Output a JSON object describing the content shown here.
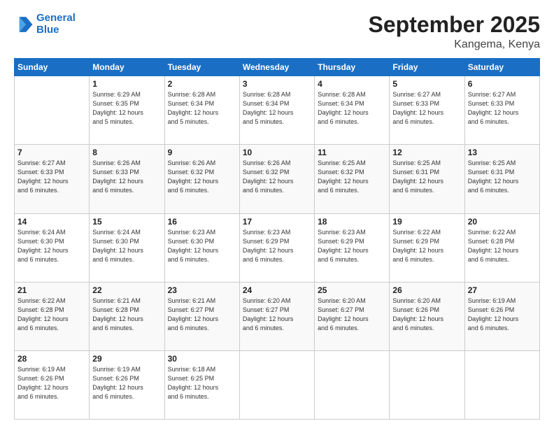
{
  "logo": {
    "line1": "General",
    "line2": "Blue"
  },
  "title": "September 2025",
  "location": "Kangema, Kenya",
  "days_header": [
    "Sunday",
    "Monday",
    "Tuesday",
    "Wednesday",
    "Thursday",
    "Friday",
    "Saturday"
  ],
  "weeks": [
    [
      {
        "num": "",
        "info": ""
      },
      {
        "num": "1",
        "info": "Sunrise: 6:29 AM\nSunset: 6:35 PM\nDaylight: 12 hours\nand 5 minutes."
      },
      {
        "num": "2",
        "info": "Sunrise: 6:28 AM\nSunset: 6:34 PM\nDaylight: 12 hours\nand 5 minutes."
      },
      {
        "num": "3",
        "info": "Sunrise: 6:28 AM\nSunset: 6:34 PM\nDaylight: 12 hours\nand 5 minutes."
      },
      {
        "num": "4",
        "info": "Sunrise: 6:28 AM\nSunset: 6:34 PM\nDaylight: 12 hours\nand 6 minutes."
      },
      {
        "num": "5",
        "info": "Sunrise: 6:27 AM\nSunset: 6:33 PM\nDaylight: 12 hours\nand 6 minutes."
      },
      {
        "num": "6",
        "info": "Sunrise: 6:27 AM\nSunset: 6:33 PM\nDaylight: 12 hours\nand 6 minutes."
      }
    ],
    [
      {
        "num": "7",
        "info": "Sunrise: 6:27 AM\nSunset: 6:33 PM\nDaylight: 12 hours\nand 6 minutes."
      },
      {
        "num": "8",
        "info": "Sunrise: 6:26 AM\nSunset: 6:33 PM\nDaylight: 12 hours\nand 6 minutes."
      },
      {
        "num": "9",
        "info": "Sunrise: 6:26 AM\nSunset: 6:32 PM\nDaylight: 12 hours\nand 6 minutes."
      },
      {
        "num": "10",
        "info": "Sunrise: 6:26 AM\nSunset: 6:32 PM\nDaylight: 12 hours\nand 6 minutes."
      },
      {
        "num": "11",
        "info": "Sunrise: 6:25 AM\nSunset: 6:32 PM\nDaylight: 12 hours\nand 6 minutes."
      },
      {
        "num": "12",
        "info": "Sunrise: 6:25 AM\nSunset: 6:31 PM\nDaylight: 12 hours\nand 6 minutes."
      },
      {
        "num": "13",
        "info": "Sunrise: 6:25 AM\nSunset: 6:31 PM\nDaylight: 12 hours\nand 6 minutes."
      }
    ],
    [
      {
        "num": "14",
        "info": "Sunrise: 6:24 AM\nSunset: 6:30 PM\nDaylight: 12 hours\nand 6 minutes."
      },
      {
        "num": "15",
        "info": "Sunrise: 6:24 AM\nSunset: 6:30 PM\nDaylight: 12 hours\nand 6 minutes."
      },
      {
        "num": "16",
        "info": "Sunrise: 6:23 AM\nSunset: 6:30 PM\nDaylight: 12 hours\nand 6 minutes."
      },
      {
        "num": "17",
        "info": "Sunrise: 6:23 AM\nSunset: 6:29 PM\nDaylight: 12 hours\nand 6 minutes."
      },
      {
        "num": "18",
        "info": "Sunrise: 6:23 AM\nSunset: 6:29 PM\nDaylight: 12 hours\nand 6 minutes."
      },
      {
        "num": "19",
        "info": "Sunrise: 6:22 AM\nSunset: 6:29 PM\nDaylight: 12 hours\nand 6 minutes."
      },
      {
        "num": "20",
        "info": "Sunrise: 6:22 AM\nSunset: 6:28 PM\nDaylight: 12 hours\nand 6 minutes."
      }
    ],
    [
      {
        "num": "21",
        "info": "Sunrise: 6:22 AM\nSunset: 6:28 PM\nDaylight: 12 hours\nand 6 minutes."
      },
      {
        "num": "22",
        "info": "Sunrise: 6:21 AM\nSunset: 6:28 PM\nDaylight: 12 hours\nand 6 minutes."
      },
      {
        "num": "23",
        "info": "Sunrise: 6:21 AM\nSunset: 6:27 PM\nDaylight: 12 hours\nand 6 minutes."
      },
      {
        "num": "24",
        "info": "Sunrise: 6:20 AM\nSunset: 6:27 PM\nDaylight: 12 hours\nand 6 minutes."
      },
      {
        "num": "25",
        "info": "Sunrise: 6:20 AM\nSunset: 6:27 PM\nDaylight: 12 hours\nand 6 minutes."
      },
      {
        "num": "26",
        "info": "Sunrise: 6:20 AM\nSunset: 6:26 PM\nDaylight: 12 hours\nand 6 minutes."
      },
      {
        "num": "27",
        "info": "Sunrise: 6:19 AM\nSunset: 6:26 PM\nDaylight: 12 hours\nand 6 minutes."
      }
    ],
    [
      {
        "num": "28",
        "info": "Sunrise: 6:19 AM\nSunset: 6:26 PM\nDaylight: 12 hours\nand 6 minutes."
      },
      {
        "num": "29",
        "info": "Sunrise: 6:19 AM\nSunset: 6:26 PM\nDaylight: 12 hours\nand 6 minutes."
      },
      {
        "num": "30",
        "info": "Sunrise: 6:18 AM\nSunset: 6:25 PM\nDaylight: 12 hours\nand 6 minutes."
      },
      {
        "num": "",
        "info": ""
      },
      {
        "num": "",
        "info": ""
      },
      {
        "num": "",
        "info": ""
      },
      {
        "num": "",
        "info": ""
      }
    ]
  ]
}
